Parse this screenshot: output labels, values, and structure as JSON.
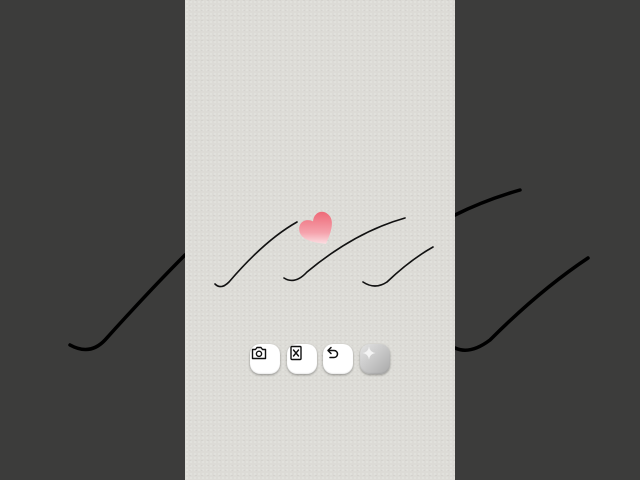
{
  "colors": {
    "backdrop": "#3c3c3b",
    "paper": "#dcdbd6",
    "ink": "#111111",
    "heart_top": "#ee6a78",
    "heart_bottom": "#ffffff",
    "button_bg": "#ffffff",
    "magic_button_bg": "#bdbdbd"
  },
  "canvas": {
    "strokes": [
      {
        "name": "stroke-left"
      },
      {
        "name": "stroke-middle"
      },
      {
        "name": "stroke-right"
      }
    ],
    "sticker": {
      "icon": "heart-icon"
    }
  },
  "toolbar": {
    "buttons": [
      {
        "name": "camera-button",
        "icon": "camera-icon"
      },
      {
        "name": "clear-button",
        "icon": "clear-canvas-icon"
      },
      {
        "name": "undo-button",
        "icon": "undo-icon"
      },
      {
        "name": "magic-button",
        "icon": "sparkle-icon"
      }
    ]
  }
}
